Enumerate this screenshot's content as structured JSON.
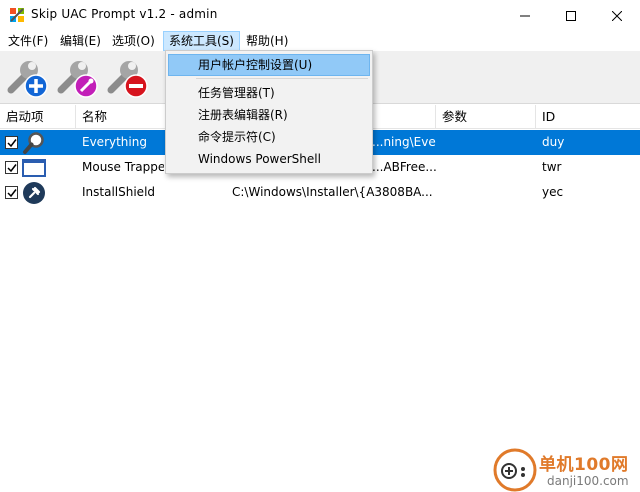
{
  "window": {
    "title": "Skip UAC Prompt v1.2 - admin"
  },
  "menubar": {
    "items": [
      "文件(F)",
      "编辑(E)",
      "选项(O)",
      "系统工具(S)",
      "帮助(H)"
    ],
    "active_index": 3
  },
  "toolbar": {
    "buttons": [
      "wrench-add-icon",
      "wrench-edit-icon",
      "wrench-remove-icon"
    ]
  },
  "listview": {
    "columns": [
      "启动项",
      "名称",
      "",
      "参数",
      "ID"
    ],
    "rows": [
      {
        "checked": true,
        "icon": "magnifier-icon",
        "name": "Everything",
        "path": "...ning\\Eve...",
        "args": "",
        "id": "duy",
        "selected": true
      },
      {
        "checked": true,
        "icon": "monitor-icon",
        "name": "Mouse Trappe",
        "path": "...ABFree...",
        "args": "",
        "id": "twr",
        "selected": false
      },
      {
        "checked": true,
        "icon": "pin-icon",
        "name": "InstallShield",
        "path": "C:\\Windows\\Installer\\{A3808BA...",
        "args": "",
        "id": "yec",
        "selected": false
      }
    ]
  },
  "dropdown": {
    "items": [
      "用户帐户控制设置(U)",
      "任务管理器(T)",
      "注册表编辑器(R)",
      "命令提示符(C)",
      "Windows PowerShell"
    ],
    "hover_index": 0
  },
  "watermark": {
    "cn": "单机100网",
    "url": "danji100.com"
  },
  "colors": {
    "selection": "#0078d7",
    "menu_hover": "#91c9f7",
    "watermark": "#e07a2a"
  }
}
